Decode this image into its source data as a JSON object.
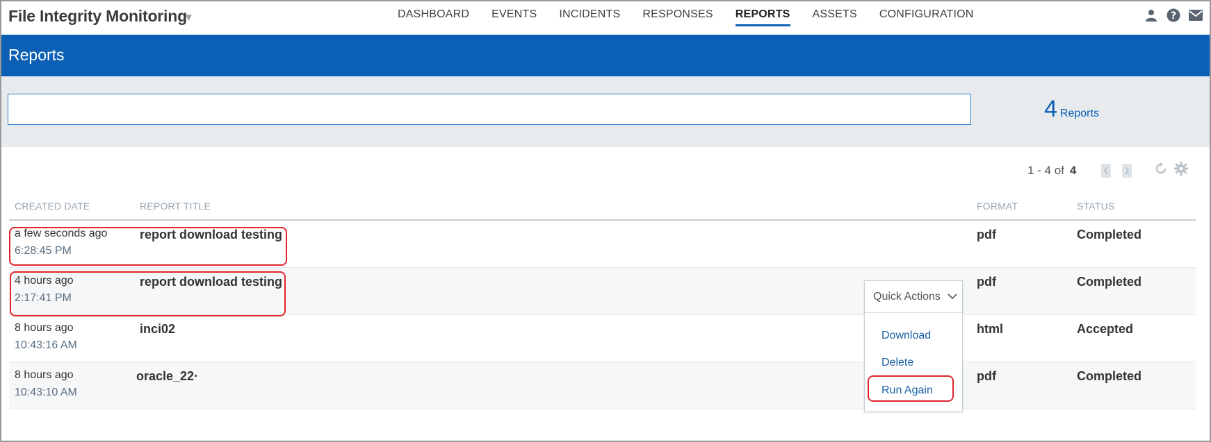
{
  "app": {
    "title": "File Integrity Monitoring"
  },
  "nav": {
    "items": [
      {
        "label": "DASHBOARD",
        "active": false
      },
      {
        "label": "EVENTS",
        "active": false
      },
      {
        "label": "INCIDENTS",
        "active": false
      },
      {
        "label": "RESPONSES",
        "active": false
      },
      {
        "label": "REPORTS",
        "active": true
      },
      {
        "label": "ASSETS",
        "active": false
      },
      {
        "label": "CONFIGURATION",
        "active": false
      }
    ]
  },
  "icons": {
    "user": "user-icon",
    "help": "help-icon",
    "mail": "mail-icon"
  },
  "page": {
    "title": "Reports"
  },
  "search": {
    "value": "",
    "placeholder": ""
  },
  "summary": {
    "count": "4",
    "label": "Reports"
  },
  "pagination": {
    "range": "1 - 4 of",
    "total": "4"
  },
  "table": {
    "columns": {
      "created": "CREATED DATE",
      "title": "REPORT TITLE",
      "format": "FORMAT",
      "status": "STATUS"
    },
    "rows": [
      {
        "relative": "a few seconds ago",
        "time": "6:28:45 PM",
        "title": "report download testing",
        "format": "pdf",
        "status": "Completed"
      },
      {
        "relative": "4 hours ago",
        "time": "2:17:41 PM",
        "title": "report download testing",
        "format": "pdf",
        "status": "Completed"
      },
      {
        "relative": "8 hours ago",
        "time": "10:43:16 AM",
        "title": "inci02",
        "format": "html",
        "status": "Accepted"
      },
      {
        "relative": "8 hours ago",
        "time": "10:43:10 AM",
        "title": "oracle_22·",
        "format": "pdf",
        "status": "Completed"
      }
    ]
  },
  "quick_actions": {
    "label": "Quick Actions",
    "items": [
      "Download",
      "Delete",
      "Run Again"
    ]
  },
  "colors": {
    "brand": "#0b5fb5",
    "highlight": "#e0262a",
    "link": "#1a5fa8"
  }
}
